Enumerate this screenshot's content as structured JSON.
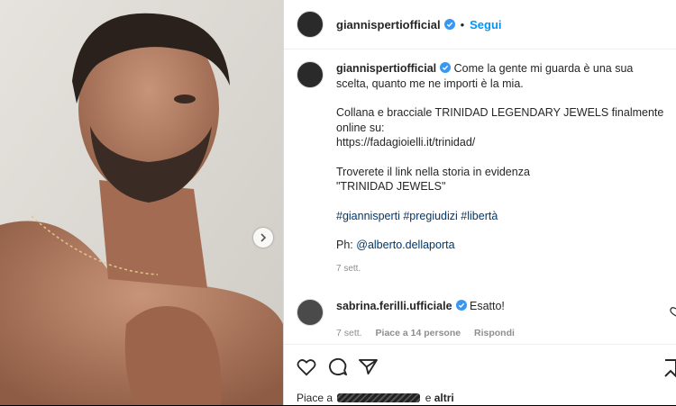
{
  "post": {
    "username": "giannispertiofficial",
    "separator": "•",
    "follow_label": "Segui"
  },
  "caption": {
    "username": "giannispertiofficial",
    "line1": "Come la gente mi guarda è una sua scelta, quanto me ne importi è la mia.",
    "line2a": "Collana e bracciale TRINIDAD LEGENDARY JEWELS finalmente online su:",
    "line2b": "https://fadagioielli.it/trinidad/",
    "line3a": "Troverete il link nella storia in evidenza",
    "line3b": "\"TRINIDAD JEWELS\"",
    "hashtags": "#giannisperti #pregiudizi #libertà",
    "credit_prefix": "Ph: ",
    "credit_mention": "@alberto.dellaporta",
    "time": "7 sett."
  },
  "comment": {
    "username": "sabrina.ferilli.ufficiale",
    "text": "Esatto!",
    "time": "7 sett.",
    "likes_label": "Piace a 14 persone",
    "reply_label": "Rispondi"
  },
  "likes": {
    "prefix": "Piace a",
    "suffix_and": "e",
    "suffix_others": "altri"
  },
  "colors": {
    "link_blue": "#0095f6",
    "tag_blue": "#00376b",
    "verified_blue": "#3897f0"
  },
  "icons": [
    "chevron-right-icon",
    "verified-icon",
    "heart-icon",
    "comment-icon",
    "share-icon",
    "bookmark-icon"
  ]
}
